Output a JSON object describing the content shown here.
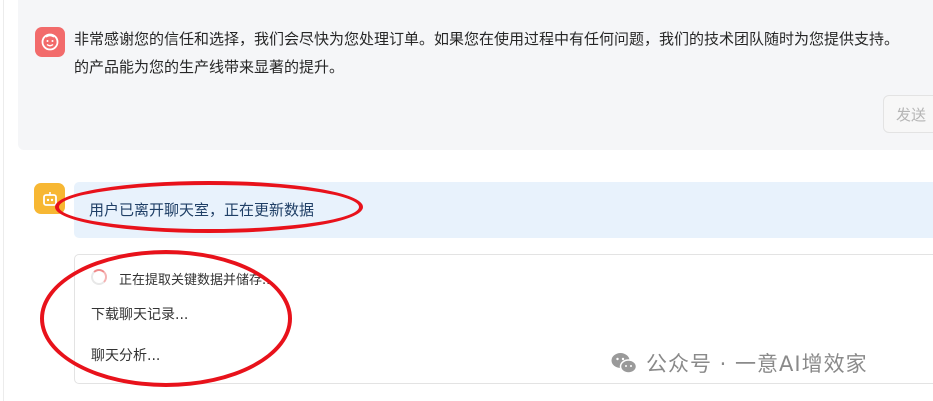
{
  "conversation": {
    "user_message": "非常感谢您的信任和选择，我们会尽快为您处理订单。如果您在使用过程中有任何问题，我们的技术团队随时为您提供支持。\n的产品能为您的生产线带来显著的提升。",
    "send_label": "发送"
  },
  "bot": {
    "status": "用户已离开聊天室，正在更新数据",
    "tasks": [
      "正在提取关键数据并储存...",
      "下载聊天记录...",
      "聊天分析..."
    ]
  },
  "watermark": {
    "text": "公众号 · 一意AI增效家",
    "icon": "wechat-icon"
  },
  "colors": {
    "annotation": "#e8121b",
    "user_avatar": "#f26b6b",
    "bot_avatar": "#f7b733",
    "banner_bg": "#e8f2fc"
  }
}
